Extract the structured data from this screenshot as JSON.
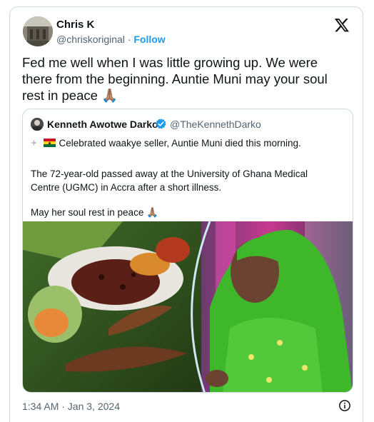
{
  "author": {
    "name": "Chris K",
    "handle": "@chriskoriginal",
    "separator": "·",
    "follow_label": "Follow"
  },
  "tweet": {
    "text": "Fed me well when I was little growing up. We were there from the beginning. Auntie Muni may your soul rest in peace 🙏🏽"
  },
  "quoted": {
    "name": "Kenneth Awotwe Darko",
    "handle": "@TheKennethDarko",
    "line1": "Celebrated waakye seller, Auntie Muni died this morning.",
    "line2": "The 72-year-old passed away at the University of Ghana Medical",
    "line3": "Centre (UGMC) in Accra after a short illness.",
    "line4": "May her soul rest in peace 🙏🏽"
  },
  "footer": {
    "timestamp": "1:34 AM · Jan 3, 2024"
  },
  "icons": {
    "platform": "x-logo-icon",
    "verified": "verified-badge-icon",
    "info": "info-icon"
  },
  "colors": {
    "accent": "#1d9bf0",
    "muted": "#536471",
    "border": "#cfd9de"
  }
}
